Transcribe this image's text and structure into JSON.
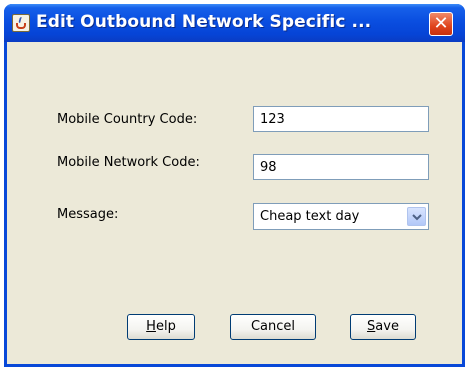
{
  "window": {
    "title": "Edit Outbound Network Specific ...",
    "close_glyph": "✕"
  },
  "form": {
    "mcc_label": "Mobile Country Code:",
    "mcc_value": "123",
    "mnc_label": "Mobile Network Code:",
    "mnc_value": "98",
    "message_label": "Message:",
    "message_selected": "Cheap text day"
  },
  "buttons": {
    "help_mnemonic": "H",
    "help_rest": "elp",
    "cancel": "Cancel",
    "save_mnemonic": "S",
    "save_rest": "ave"
  },
  "icons": {
    "app": "java-cup-icon",
    "close": "close-icon",
    "dropdown": "chevron-down-icon"
  },
  "colors": {
    "titlebar": "#0a4ee0",
    "close": "#e0441c",
    "dialog_bg": "#ece9d8",
    "field_border": "#7f9db9"
  }
}
